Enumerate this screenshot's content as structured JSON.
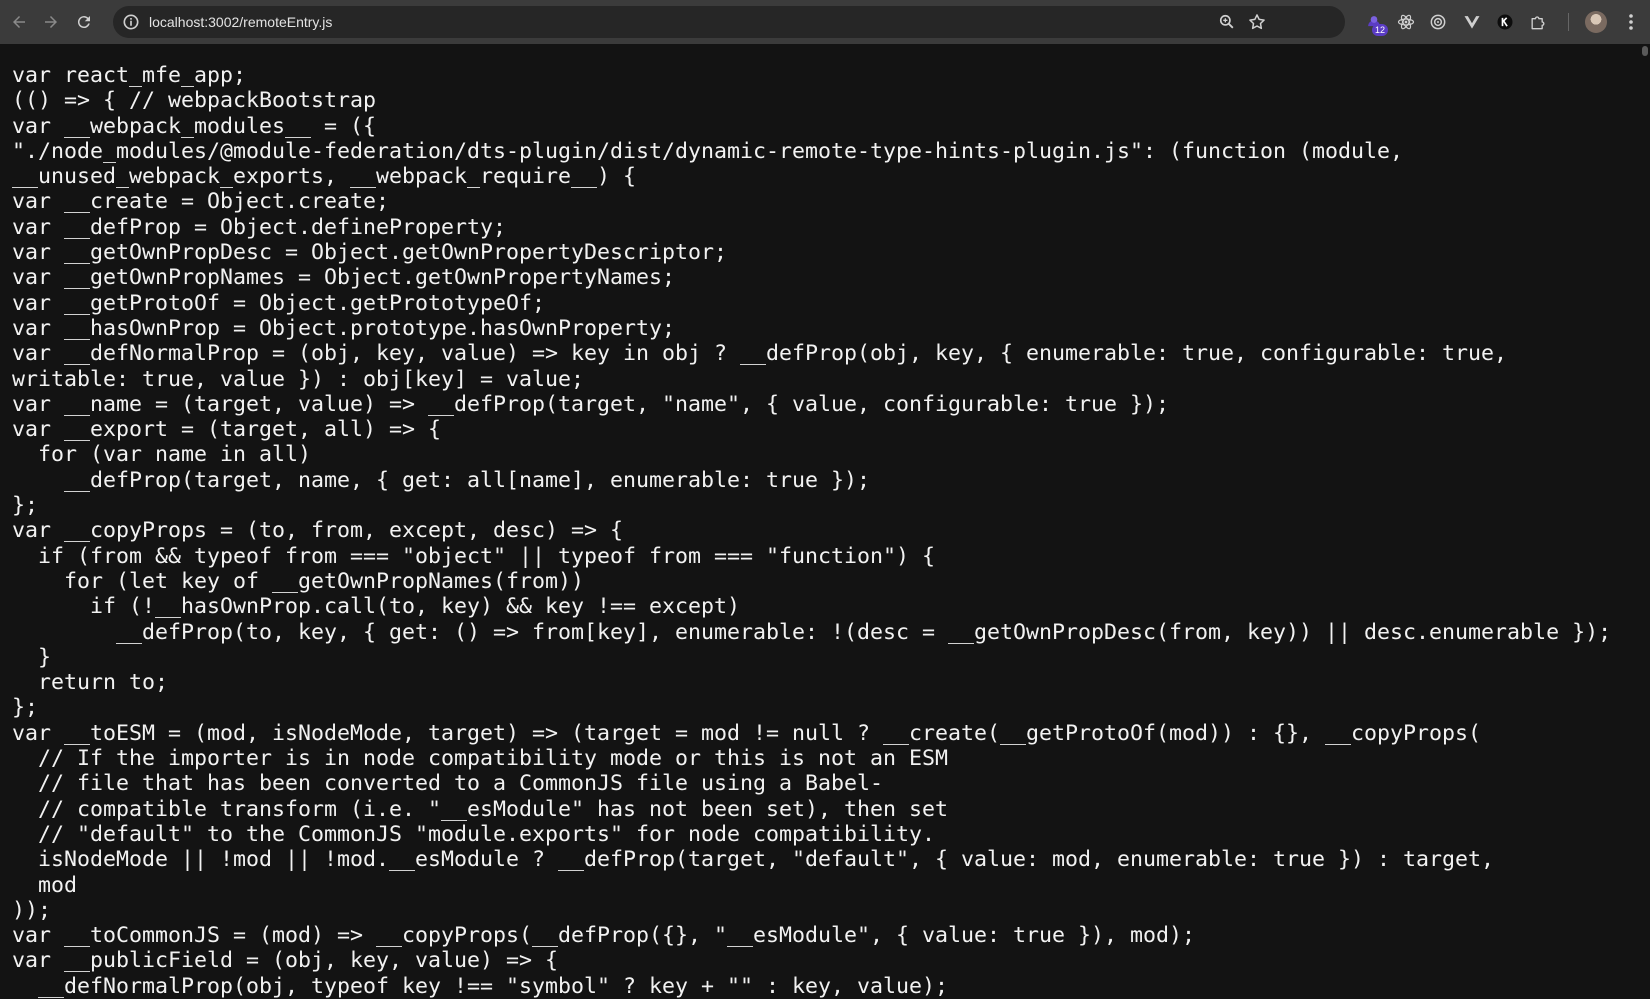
{
  "browser": {
    "url": "localhost:3002/remoteEntry.js",
    "extension_badge": "12",
    "icons": [
      "back-arrow-icon",
      "forward-arrow-icon",
      "reload-icon",
      "info-icon",
      "zoom-icon",
      "star-icon",
      "extension-icon",
      "react-icon",
      "target-icon",
      "vue-icon",
      "k-icon",
      "puzzle-icon",
      "avatar",
      "kebab-menu-icon"
    ]
  },
  "code_lines": [
    "var react_mfe_app;",
    "(() => { // webpackBootstrap",
    "var __webpack_modules__ = ({",
    "\"./node_modules/@module-federation/dts-plugin/dist/dynamic-remote-type-hints-plugin.js\": (function (module,",
    "__unused_webpack_exports, __webpack_require__) {",
    "var __create = Object.create;",
    "var __defProp = Object.defineProperty;",
    "var __getOwnPropDesc = Object.getOwnPropertyDescriptor;",
    "var __getOwnPropNames = Object.getOwnPropertyNames;",
    "var __getProtoOf = Object.getPrototypeOf;",
    "var __hasOwnProp = Object.prototype.hasOwnProperty;",
    "var __defNormalProp = (obj, key, value) => key in obj ? __defProp(obj, key, { enumerable: true, configurable: true,",
    "writable: true, value }) : obj[key] = value;",
    "var __name = (target, value) => __defProp(target, \"name\", { value, configurable: true });",
    "var __export = (target, all) => {",
    "  for (var name in all)",
    "    __defProp(target, name, { get: all[name], enumerable: true });",
    "};",
    "var __copyProps = (to, from, except, desc) => {",
    "  if (from && typeof from === \"object\" || typeof from === \"function\") {",
    "    for (let key of __getOwnPropNames(from))",
    "      if (!__hasOwnProp.call(to, key) && key !== except)",
    "        __defProp(to, key, { get: () => from[key], enumerable: !(desc = __getOwnPropDesc(from, key)) || desc.enumerable });",
    "  }",
    "  return to;",
    "};",
    "var __toESM = (mod, isNodeMode, target) => (target = mod != null ? __create(__getProtoOf(mod)) : {}, __copyProps(",
    "  // If the importer is in node compatibility mode or this is not an ESM",
    "  // file that has been converted to a CommonJS file using a Babel-",
    "  // compatible transform (i.e. \"__esModule\" has not been set), then set",
    "  // \"default\" to the CommonJS \"module.exports\" for node compatibility.",
    "  isNodeMode || !mod || !mod.__esModule ? __defProp(target, \"default\", { value: mod, enumerable: true }) : target,",
    "  mod",
    "));",
    "var __toCommonJS = (mod) => __copyProps(__defProp({}, \"__esModule\", { value: true }), mod);",
    "var __publicField = (obj, key, value) => {",
    "  __defNormalProp(obj, typeof key !== \"symbol\" ? key + \"\" : key, value);"
  ]
}
